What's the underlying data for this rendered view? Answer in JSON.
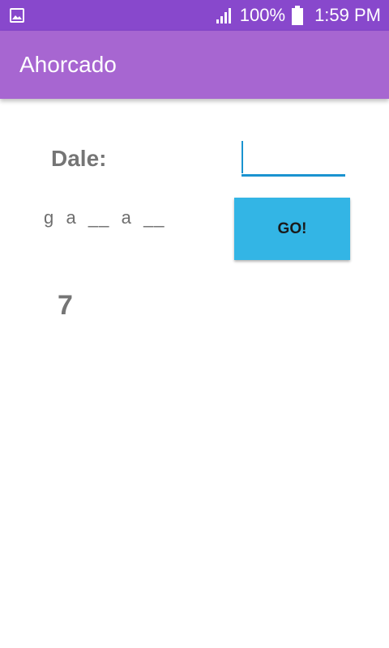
{
  "status_bar": {
    "notification_icon": "gallery-icon",
    "signal_icon": "signal-icon",
    "battery_icon": "battery-icon",
    "battery_text": "100%",
    "time": "1:59 PM",
    "background_color": "#8848cc"
  },
  "app_bar": {
    "title": "Ahorcado",
    "background_color": "#a766d1"
  },
  "game": {
    "prompt_label": "Dale:",
    "input_value": "",
    "masked_word": "g  a  __  a  __",
    "go_button_label": "GO!",
    "go_button_color": "#33b5e5",
    "attempts_left": "7"
  }
}
